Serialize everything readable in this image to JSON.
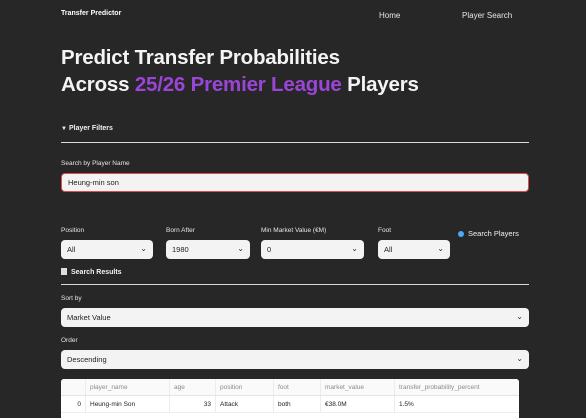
{
  "nav": {
    "brand": "Transfer Predictor",
    "items": [
      "Home",
      "Player Search"
    ]
  },
  "hero": {
    "line1": "Predict Transfer Probabilities",
    "line2_prefix": "Across ",
    "line2_accent": "25/26 Premier League",
    "line2_suffix": " Players"
  },
  "filters": {
    "expander_label": "Player Filters",
    "search_label": "Search by Player Name",
    "search_value": "Heung-min son",
    "position": {
      "label": "Position",
      "value": "All"
    },
    "born_after": {
      "label": "Born After",
      "value": "1980"
    },
    "min_market_value": {
      "label": "Min Market Value (€M)",
      "value": "0"
    },
    "foot": {
      "label": "Foot",
      "value": "All"
    },
    "search_button": "Search Players"
  },
  "results": {
    "heading": "Search Results",
    "sort_by": {
      "label": "Sort by",
      "value": "Market Value"
    },
    "order": {
      "label": "Order",
      "value": "Descending"
    },
    "table": {
      "columns": [
        "",
        "player_name",
        "age",
        "position",
        "foot",
        "market_value",
        "transfer_probability_percent"
      ],
      "rows": [
        [
          "0",
          "Heung-min Son",
          "33",
          "Attack",
          "both",
          "€38.0M",
          "1.5%"
        ]
      ]
    }
  },
  "colors": {
    "background": "#272727",
    "accent": "#9b45d6",
    "input_error_border": "#e24b4b",
    "search_icon": "#4aa8ff"
  }
}
